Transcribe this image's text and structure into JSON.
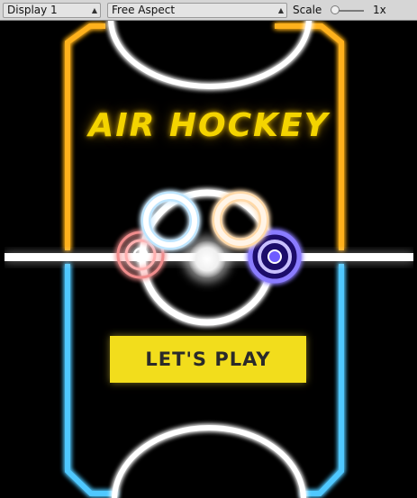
{
  "toolbar": {
    "display": "Display 1",
    "aspect": "Free Aspect",
    "scale_label": "Scale",
    "scale_value": "1x"
  },
  "game": {
    "title": "AIR HOCKEY",
    "play_label": "LET'S PLAY"
  },
  "colors": {
    "top_half": "#ffb11c",
    "bottom_half": "#4fc8ff",
    "title": "#f4d400",
    "button": "#f2dd1c",
    "center_line": "#ffffff"
  },
  "icons": {
    "mallet_red": "red-ring-mallet-icon",
    "mallet_white": "white-ring-icon",
    "mallet_cream": "cream-ring-icon",
    "mallet_blue": "blue-ring-mallet-icon"
  }
}
